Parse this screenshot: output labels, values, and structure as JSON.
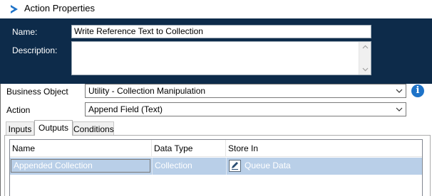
{
  "window": {
    "title": "Action Properties",
    "icon": "blue-prism-icon"
  },
  "header": {
    "name_label": "Name:",
    "name_value": "Write Reference Text to Collection",
    "description_label": "Description:",
    "description_value": ""
  },
  "form": {
    "business_object_label": "Business Object",
    "business_object_value": "Utility - Collection Manipulation",
    "action_label": "Action",
    "action_value": "Append Field (Text)",
    "info_icon": "info-icon",
    "info_glyph": "i"
  },
  "tabs": [
    {
      "label": "Inputs",
      "active": false
    },
    {
      "label": "Outputs",
      "active": true
    },
    {
      "label": "Conditions",
      "active": false
    }
  ],
  "grid": {
    "columns": [
      "Name",
      "Data Type",
      "Store In"
    ],
    "rows": [
      {
        "name": "Appended Collection",
        "data_type": "Collection",
        "store_in": "Queue Data",
        "store_icon": "data-item-icon",
        "selected": true
      }
    ]
  },
  "colors": {
    "header_bg": "#0d2b4a",
    "selection": "#b9cfe8",
    "accent": "#1e73c8"
  }
}
